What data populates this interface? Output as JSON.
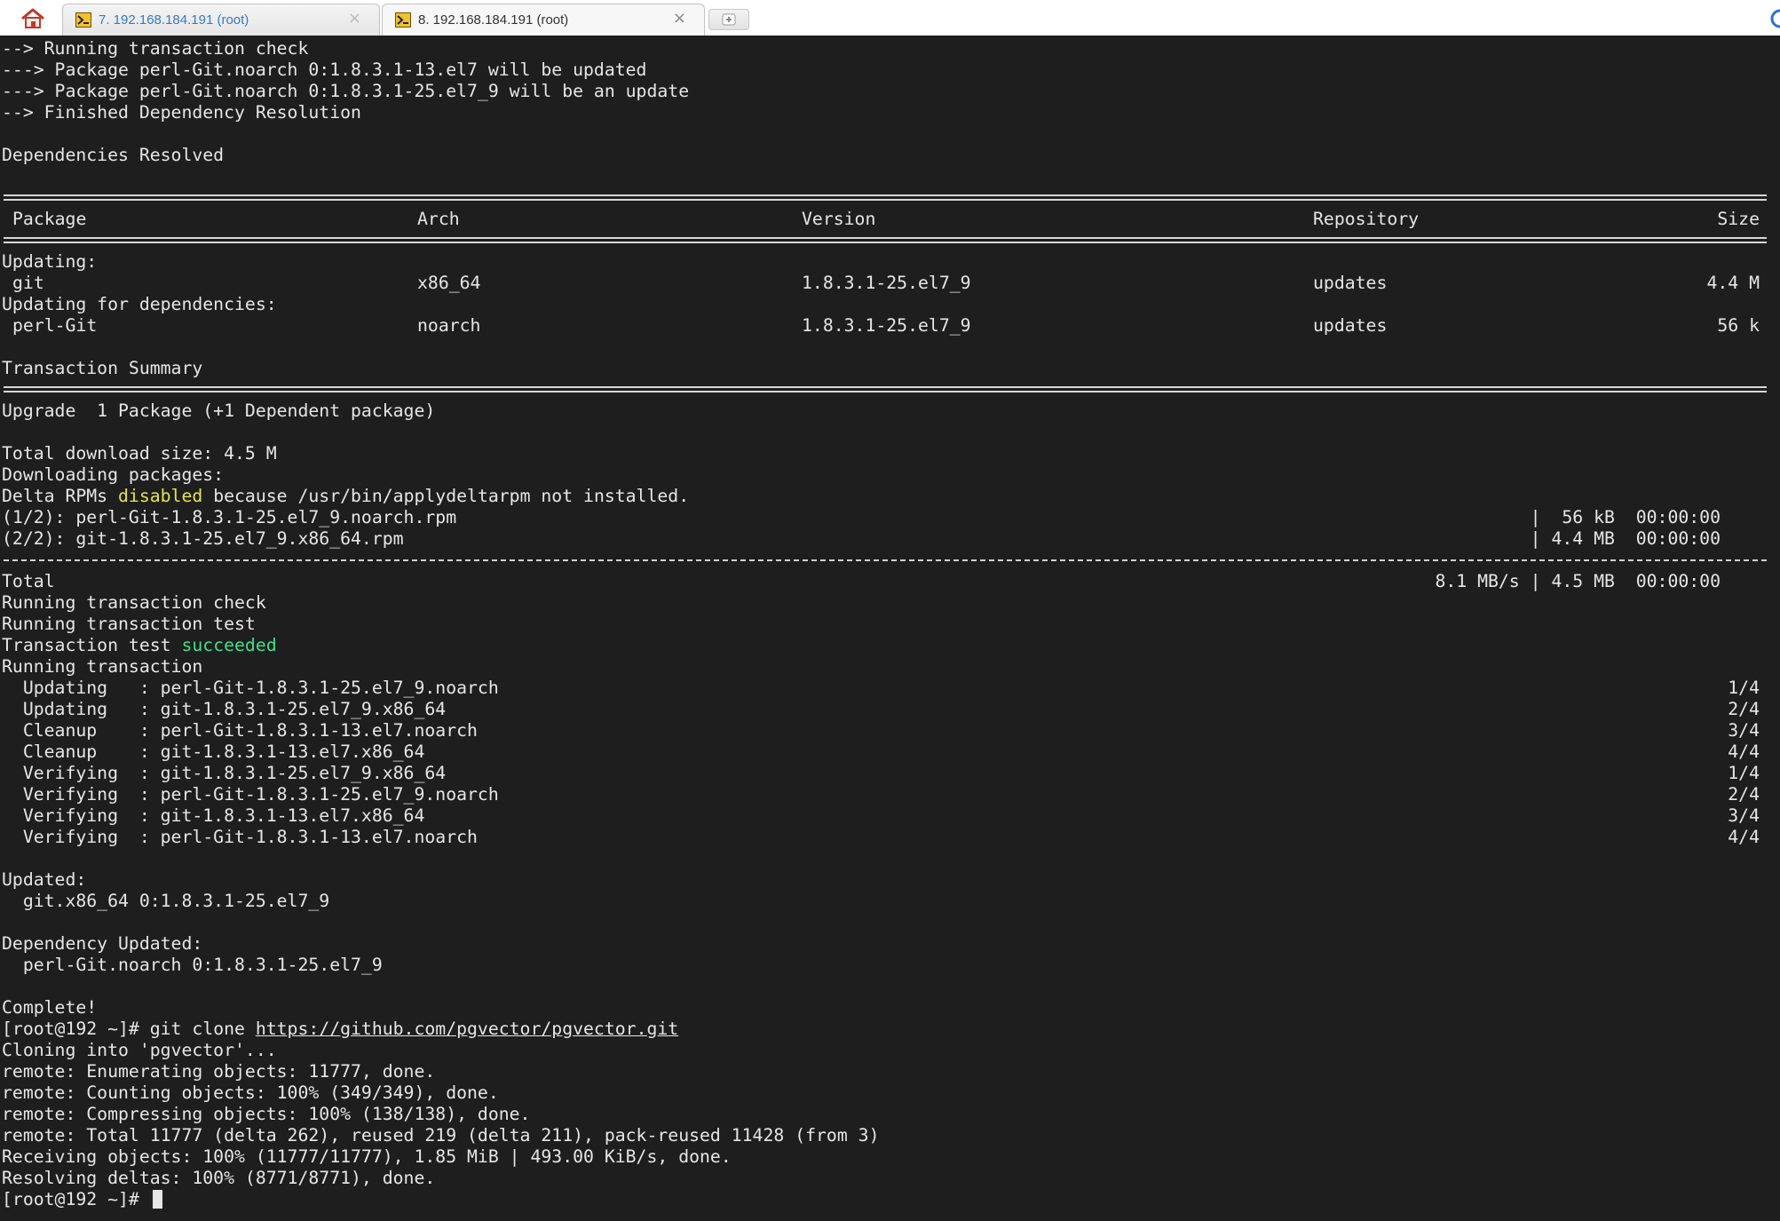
{
  "tabs": [
    {
      "label": "7. 192.168.184.191 (root)",
      "active": false
    },
    {
      "label": "8. 192.168.184.191 (root)",
      "active": true
    }
  ],
  "tab_close_glyph": "×",
  "icons": {
    "home": "home-icon",
    "session": "terminal-session-icon",
    "new_tab": "plus-icon",
    "browser": "browser-icon"
  },
  "colors": {
    "terminal_bg": "#1e1e1e",
    "terminal_fg": "#e6e6e6",
    "highlight_yellow": "#e8e24a",
    "highlight_green": "#3ee08a",
    "tab_text": "#3a78c8"
  },
  "terminal": {
    "check": {
      "l1": "--> Running transaction check",
      "l2": "---> Package perl-Git.noarch 0:1.8.3.1-13.el7 will be updated",
      "l3": "---> Package perl-Git.noarch 0:1.8.3.1-25.el7_9 will be an update",
      "l4": "--> Finished Dependency Resolution",
      "resolved": "Dependencies Resolved"
    },
    "table": {
      "headers": {
        "package": "Package",
        "arch": "Arch",
        "version": "Version",
        "repository": "Repository",
        "size": "Size"
      },
      "updating_label": "Updating:",
      "deps_label": "Updating for dependencies:",
      "rows": [
        {
          "package": "git",
          "arch": "x86_64",
          "version": "1.8.3.1-25.el7_9",
          "repository": "updates",
          "size": "4.4 M"
        },
        {
          "package": "perl-Git",
          "arch": "noarch",
          "version": "1.8.3.1-25.el7_9",
          "repository": "updates",
          "size": "56 k"
        }
      ]
    },
    "summary": {
      "title": "Transaction Summary",
      "upgrade": "Upgrade  1 Package (+1 Dependent package)",
      "total_size": "Total download size: 4.5 M",
      "downloading": "Downloading packages:",
      "delta_prefix": "Delta RPMs ",
      "delta_highlight": "disabled",
      "delta_suffix": " because /usr/bin/applydeltarpm not installed."
    },
    "downloads": [
      {
        "name": "(1/2): perl-Git-1.8.3.1-25.el7_9.noarch.rpm",
        "stats": "|  56 kB  00:00:00"
      },
      {
        "name": "(2/2): git-1.8.3.1-25.el7_9.x86_64.rpm",
        "stats": "| 4.4 MB  00:00:00"
      }
    ],
    "total": {
      "label": "Total",
      "stats": "8.1 MB/s | 4.5 MB  00:00:00"
    },
    "run": {
      "check": "Running transaction check",
      "test": "Running transaction test",
      "test_prefix": "Transaction test ",
      "test_highlight": "succeeded",
      "running": "Running transaction"
    },
    "steps": [
      {
        "text": "  Updating   : perl-Git-1.8.3.1-25.el7_9.noarch",
        "count": "1/4"
      },
      {
        "text": "  Updating   : git-1.8.3.1-25.el7_9.x86_64",
        "count": "2/4"
      },
      {
        "text": "  Cleanup    : perl-Git-1.8.3.1-13.el7.noarch",
        "count": "3/4"
      },
      {
        "text": "  Cleanup    : git-1.8.3.1-13.el7.x86_64",
        "count": "4/4"
      },
      {
        "text": "  Verifying  : git-1.8.3.1-25.el7_9.x86_64",
        "count": "1/4"
      },
      {
        "text": "  Verifying  : perl-Git-1.8.3.1-25.el7_9.noarch",
        "count": "2/4"
      },
      {
        "text": "  Verifying  : git-1.8.3.1-13.el7.x86_64",
        "count": "3/4"
      },
      {
        "text": "  Verifying  : perl-Git-1.8.3.1-13.el7.noarch",
        "count": "4/4"
      }
    ],
    "result": {
      "updated_label": "Updated:",
      "updated_pkg": "  git.x86_64 0:1.8.3.1-25.el7_9",
      "dep_label": "Dependency Updated:",
      "dep_pkg": "  perl-Git.noarch 0:1.8.3.1-25.el7_9",
      "complete": "Complete!"
    },
    "clone": {
      "prompt": "[root@192 ~]# ",
      "command": "git clone ",
      "url": "https://github.com/pgvector/pgvector.git",
      "cloning": "Cloning into 'pgvector'...",
      "enumerating": "remote: Enumerating objects: 11777, done.",
      "counting": "remote: Counting objects: 100% (349/349), done.",
      "compressing": "remote: Compressing objects: 100% (138/138), done.",
      "total": "remote: Total 11777 (delta 262), reused 219 (delta 211), pack-reused 11428 (from 3)",
      "receiving": "Receiving objects: 100% (11777/11777), 1.85 MiB | 493.00 KiB/s, done.",
      "resolving": "Resolving deltas: 100% (8771/8771), done.",
      "final_prompt": "[root@192 ~]# "
    }
  }
}
